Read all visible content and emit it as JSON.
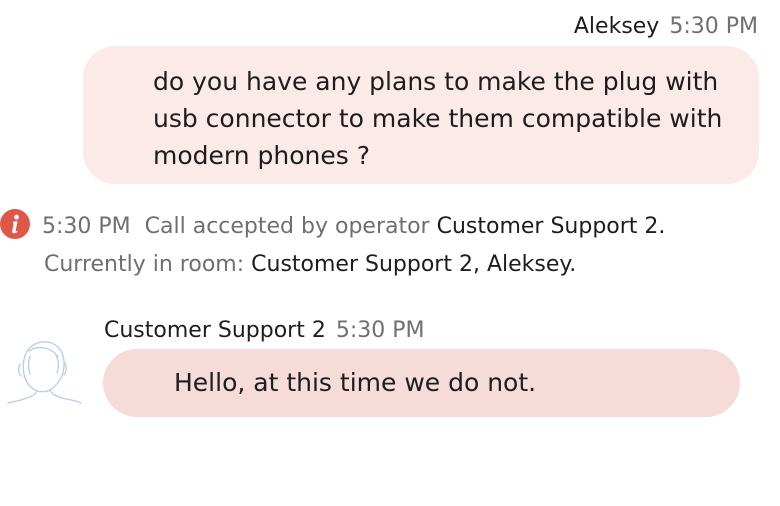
{
  "outgoing": {
    "sender": "Aleksey",
    "time": "5:30 PM",
    "text": "do you have any plans to make the plug with usb connector to make them compatible with modern phones ?"
  },
  "notice": {
    "icon": "info-icon",
    "icon_color": "#e0574a",
    "time": "5:30 PM",
    "text_prefix": "Call accepted by operator",
    "operator": "Customer Support 2.",
    "room_label": "Currently in room:",
    "room_members": "Customer Support 2, Aleksey."
  },
  "incoming": {
    "sender": "Customer Support 2",
    "time": "5:30 PM",
    "text": "Hello, at this time we do not.",
    "avatar_icon": "person-silhouette-icon"
  },
  "colors": {
    "outgoing_bubble": "#fbeae8",
    "incoming_bubble": "#f5dcd8",
    "muted_text": "#6f6f6f",
    "avatar_stroke": "#b7cde3"
  }
}
